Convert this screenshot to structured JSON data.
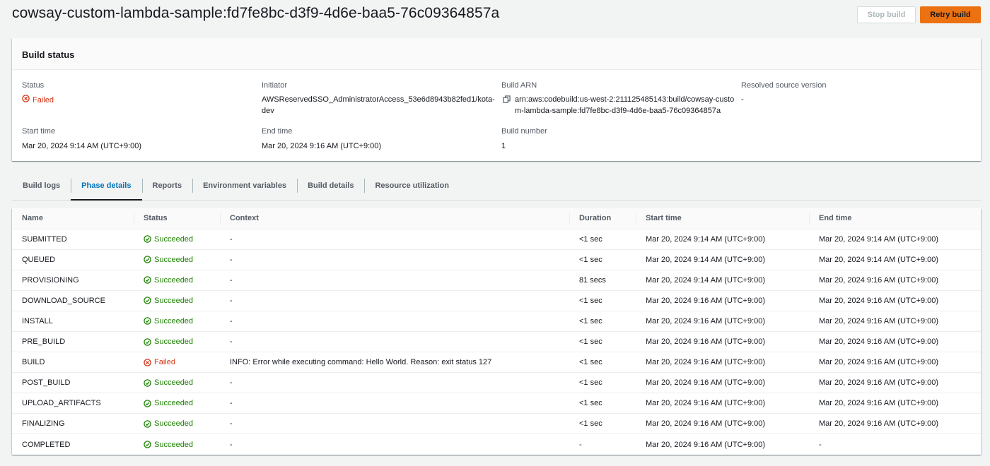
{
  "header": {
    "title": "cowsay-custom-lambda-sample:fd7fe8bc-d3f9-4d6e-baa5-76c09364857a",
    "stop_label": "Stop build",
    "retry_label": "Retry build"
  },
  "build_status": {
    "heading": "Build status",
    "status_label": "Status",
    "status_value": "Failed",
    "initiator_label": "Initiator",
    "initiator_line1": "AWSReservedSSO_AdministratorAccess_53e6d8943b82fed1/kota-",
    "initiator_line2": "dev",
    "arn_label": "Build ARN",
    "arn_line1": "arn:aws:codebuild:us-west-2:211125485143:build/cowsay-custo",
    "arn_line2": "m-lambda-sample:fd7fe8bc-d3f9-4d6e-baa5-76c09364857a",
    "resolved_label": "Resolved source version",
    "resolved_value": "-",
    "start_label": "Start time",
    "start_value": "Mar 20, 2024 9:14 AM (UTC+9:00)",
    "end_label": "End time",
    "end_value": "Mar 20, 2024 9:16 AM (UTC+9:00)",
    "number_label": "Build number",
    "number_value": "1"
  },
  "tabs": [
    {
      "label": "Build logs"
    },
    {
      "label": "Phase details"
    },
    {
      "label": "Reports"
    },
    {
      "label": "Environment variables"
    },
    {
      "label": "Build details"
    },
    {
      "label": "Resource utilization"
    }
  ],
  "active_tab": "Phase details",
  "colors": {
    "accent": "#0073bb",
    "primary_button": "#ec7211",
    "success": "#1d8102",
    "error": "#d13212"
  },
  "phase_table": {
    "columns": [
      "Name",
      "Status",
      "Context",
      "Duration",
      "Start time",
      "End time"
    ],
    "rows": [
      {
        "name": "SUBMITTED",
        "status": "Succeeded",
        "context": "-",
        "duration": "<1 sec",
        "start": "Mar 20, 2024 9:14 AM (UTC+9:00)",
        "end": "Mar 20, 2024 9:14 AM (UTC+9:00)"
      },
      {
        "name": "QUEUED",
        "status": "Succeeded",
        "context": "-",
        "duration": "<1 sec",
        "start": "Mar 20, 2024 9:14 AM (UTC+9:00)",
        "end": "Mar 20, 2024 9:14 AM (UTC+9:00)"
      },
      {
        "name": "PROVISIONING",
        "status": "Succeeded",
        "context": "-",
        "duration": "81 secs",
        "start": "Mar 20, 2024 9:14 AM (UTC+9:00)",
        "end": "Mar 20, 2024 9:16 AM (UTC+9:00)"
      },
      {
        "name": "DOWNLOAD_SOURCE",
        "status": "Succeeded",
        "context": "-",
        "duration": "<1 sec",
        "start": "Mar 20, 2024 9:16 AM (UTC+9:00)",
        "end": "Mar 20, 2024 9:16 AM (UTC+9:00)"
      },
      {
        "name": "INSTALL",
        "status": "Succeeded",
        "context": "-",
        "duration": "<1 sec",
        "start": "Mar 20, 2024 9:16 AM (UTC+9:00)",
        "end": "Mar 20, 2024 9:16 AM (UTC+9:00)"
      },
      {
        "name": "PRE_BUILD",
        "status": "Succeeded",
        "context": "-",
        "duration": "<1 sec",
        "start": "Mar 20, 2024 9:16 AM (UTC+9:00)",
        "end": "Mar 20, 2024 9:16 AM (UTC+9:00)"
      },
      {
        "name": "BUILD",
        "status": "Failed",
        "context": "INFO: Error while executing command: Hello World. Reason: exit status 127",
        "duration": "<1 sec",
        "start": "Mar 20, 2024 9:16 AM (UTC+9:00)",
        "end": "Mar 20, 2024 9:16 AM (UTC+9:00)"
      },
      {
        "name": "POST_BUILD",
        "status": "Succeeded",
        "context": "-",
        "duration": "<1 sec",
        "start": "Mar 20, 2024 9:16 AM (UTC+9:00)",
        "end": "Mar 20, 2024 9:16 AM (UTC+9:00)"
      },
      {
        "name": "UPLOAD_ARTIFACTS",
        "status": "Succeeded",
        "context": "-",
        "duration": "<1 sec",
        "start": "Mar 20, 2024 9:16 AM (UTC+9:00)",
        "end": "Mar 20, 2024 9:16 AM (UTC+9:00)"
      },
      {
        "name": "FINALIZING",
        "status": "Succeeded",
        "context": "-",
        "duration": "<1 sec",
        "start": "Mar 20, 2024 9:16 AM (UTC+9:00)",
        "end": "Mar 20, 2024 9:16 AM (UTC+9:00)"
      },
      {
        "name": "COMPLETED",
        "status": "Succeeded",
        "context": "-",
        "duration": "-",
        "start": "Mar 20, 2024 9:16 AM (UTC+9:00)",
        "end": "-"
      }
    ]
  }
}
